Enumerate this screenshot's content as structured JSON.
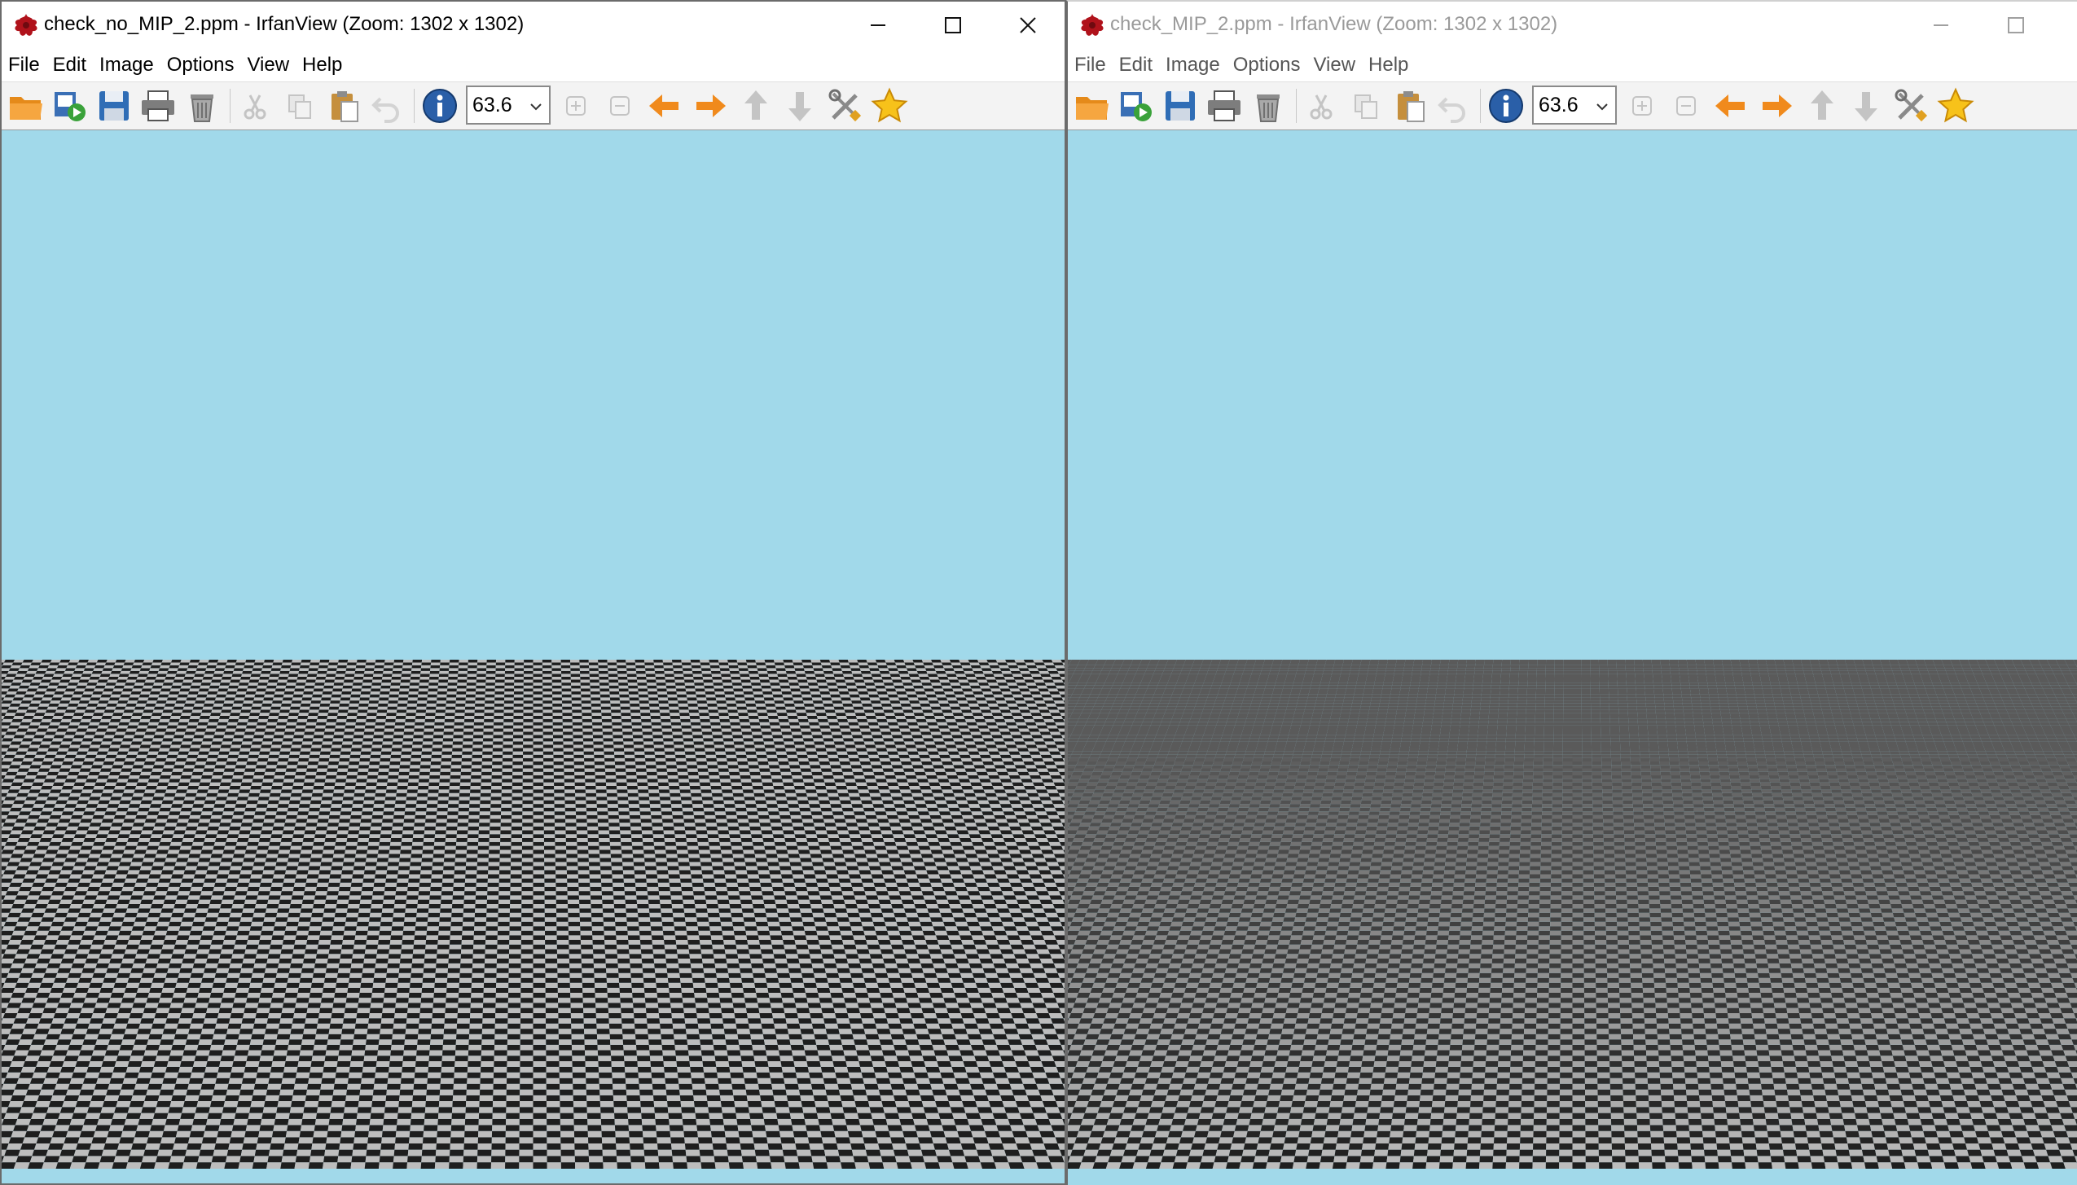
{
  "windows": [
    {
      "title": "check_no_MIP_2.ppm - IrfanView (Zoom: 1302 x 1302)",
      "active": true,
      "menu": [
        "File",
        "Edit",
        "Image",
        "Options",
        "View",
        "Help"
      ],
      "zoom_value": "63.6",
      "render": {
        "mipmapped": false,
        "sky_color": "#a1d9ea",
        "light_square": "#bdbdbd",
        "dark_square": "#1e1e1e"
      }
    },
    {
      "title": "check_MIP_2.ppm - IrfanView (Zoom: 1302 x 1302)",
      "active": false,
      "menu": [
        "File",
        "Edit",
        "Image",
        "Options",
        "View",
        "Help"
      ],
      "zoom_value": "63.6",
      "render": {
        "mipmapped": true,
        "sky_color": "#a1d9ea",
        "light_square": "#bdbdbd",
        "dark_square": "#1e1e1e",
        "far_blend": "#5a5a5a"
      }
    }
  ],
  "toolbar_icons": [
    "open-folder-icon",
    "slideshow-icon",
    "save-icon",
    "print-icon",
    "delete-trash-icon",
    "cut-icon",
    "copy-icon",
    "paste-icon",
    "undo-icon",
    "info-icon",
    "zoom-in-icon",
    "zoom-out-icon",
    "previous-arrow-icon",
    "next-arrow-icon",
    "up-arrow-icon",
    "down-arrow-icon",
    "tools-icon",
    "favorite-star-icon"
  ],
  "colors": {
    "arrow_orange": "#f08a1c",
    "info_blue": "#2a5fa8",
    "disabled_gray": "#c4c4c4",
    "title_active": "#000000",
    "title_inactive": "#9a9a9a",
    "app_icon_red": "#b0121b"
  }
}
